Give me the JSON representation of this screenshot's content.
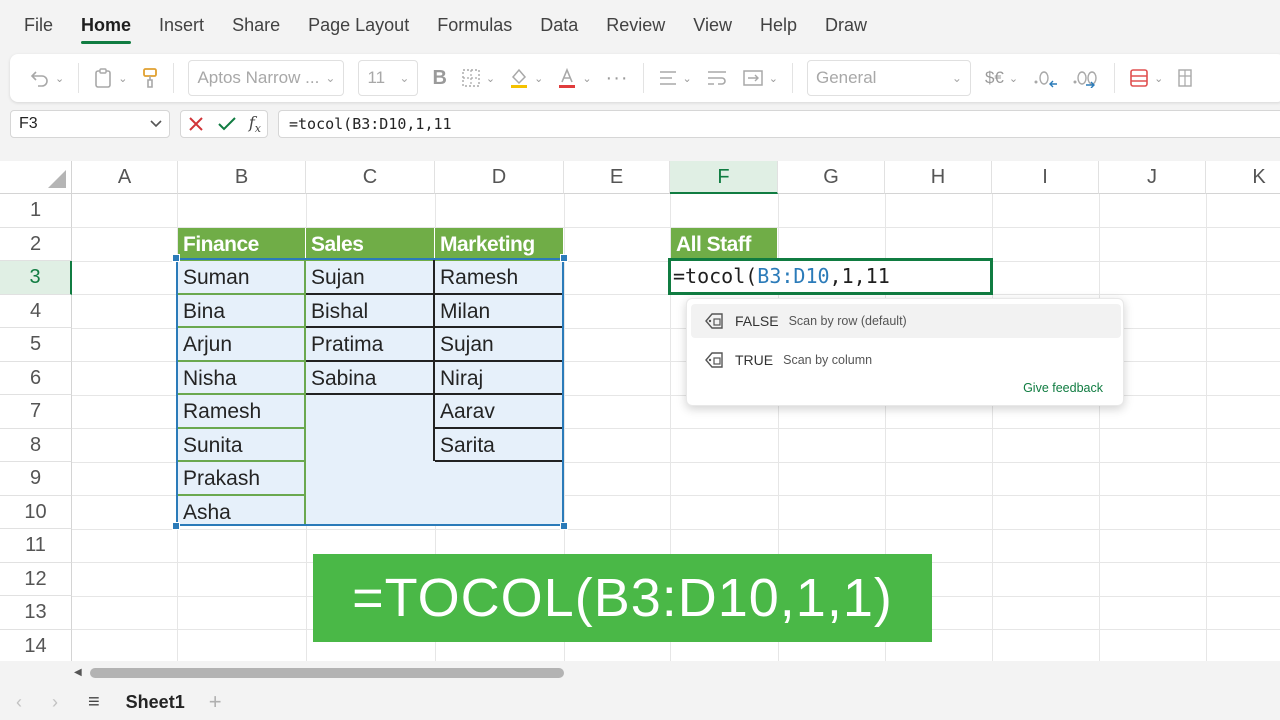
{
  "menu": {
    "tabs": [
      "File",
      "Home",
      "Insert",
      "Share",
      "Page Layout",
      "Formulas",
      "Data",
      "Review",
      "View",
      "Help",
      "Draw"
    ],
    "active": "Home"
  },
  "ribbon": {
    "font_name": "Aptos Narrow ...",
    "font_size": "11",
    "number_format": "General",
    "currency_symbol": "$€",
    "icons": [
      "undo-icon",
      "paste-icon",
      "format-painter-icon",
      "bold-icon",
      "borders-icon",
      "fill-color-icon",
      "font-color-icon",
      "more-icon",
      "align-icon",
      "wrap-text-icon",
      "merge-icon",
      "currency-icon",
      "decrease-decimal-icon",
      "increase-decimal-icon",
      "conditional-format-icon"
    ]
  },
  "formula_bar": {
    "name_box": "F3",
    "formula": "=tocol(B3:D10,1,11"
  },
  "grid": {
    "columns": [
      "A",
      "B",
      "C",
      "D",
      "E",
      "F",
      "G",
      "H",
      "I",
      "J",
      "K"
    ],
    "rows": [
      "1",
      "2",
      "3",
      "4",
      "5",
      "6",
      "7",
      "8",
      "9",
      "10",
      "11",
      "12",
      "13",
      "14"
    ],
    "selected_column": "F",
    "selected_row": "3",
    "headers": {
      "finance": "Finance",
      "sales": "Sales",
      "marketing": "Marketing",
      "all_staff": "All Staff"
    },
    "finance": [
      "Suman",
      "Bina",
      "Arjun",
      "Nisha",
      "Ramesh",
      "Sunita",
      "Prakash",
      "Asha"
    ],
    "sales": [
      "Sujan",
      "Bishal",
      "Pratima",
      "Sabina"
    ],
    "marketing": [
      "Ramesh",
      "Milan",
      "Sujan",
      "Niraj",
      "Aarav",
      "Sarita"
    ],
    "header_color": "#70ad47",
    "range_color": "#2b7bb9"
  },
  "active_cell": {
    "prefix": "=tocol(",
    "ref": "B3:D10",
    "suffix": ",1,11"
  },
  "autocomplete": {
    "options": [
      {
        "label": "FALSE",
        "desc": "Scan by row (default)"
      },
      {
        "label": "TRUE",
        "desc": "Scan by column"
      }
    ],
    "feedback": "Give feedback"
  },
  "banner": {
    "text": "=TOCOL(B3:D10,1,1)",
    "color": "#4ab847"
  },
  "sheet_tabs": {
    "sheets": [
      "Sheet1"
    ]
  }
}
